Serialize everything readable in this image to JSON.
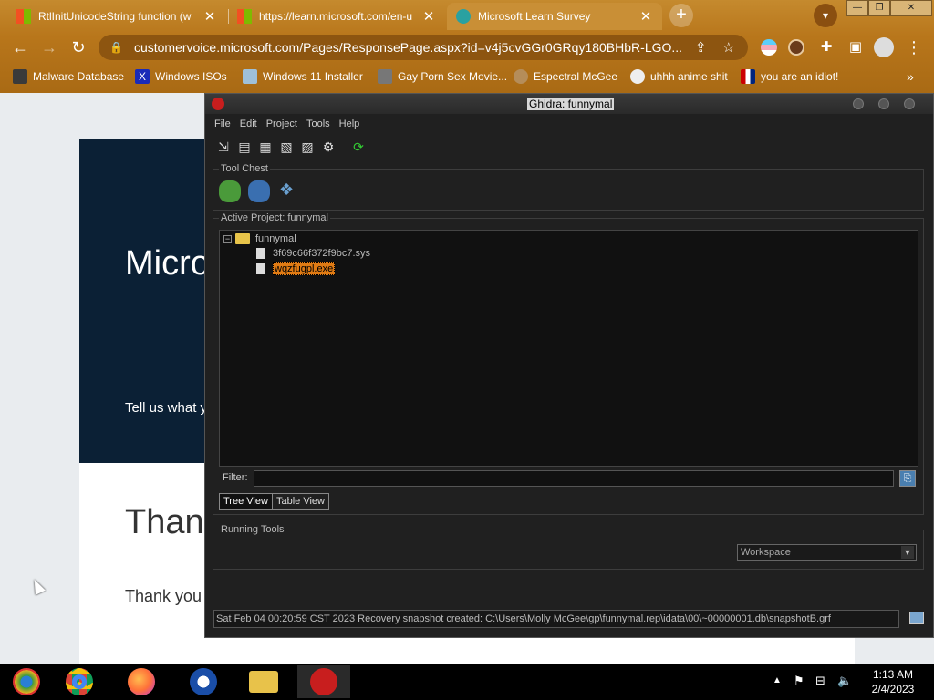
{
  "browser": {
    "tabs": [
      {
        "label": "RtlInitUnicodeString function (w",
        "close": "✕"
      },
      {
        "label": "https://learn.microsoft.com/en-u",
        "close": "✕"
      },
      {
        "label": "Microsoft Learn Survey",
        "close": "✕"
      }
    ],
    "new_tab": "+",
    "window_controls": [
      "—",
      "❐",
      "✕"
    ],
    "url": "customervoice.microsoft.com/Pages/ResponsePage.aspx?id=v4j5cvGGr0GRqy180BHbR-LGO...",
    "bookmarks": [
      {
        "label": "Malware Database"
      },
      {
        "label": "Windows ISOs"
      },
      {
        "label": "Windows 11 Installer"
      },
      {
        "label": "Gay Porn Sex Movie..."
      },
      {
        "label": "Espectral McGee"
      },
      {
        "label": "uhhh anime shit"
      },
      {
        "label": "you are an idiot!"
      }
    ],
    "bookmarks_more": "»"
  },
  "webpage": {
    "hero_title": "Microsoft Learn Survey",
    "hero_text": "Tell us what you think",
    "thanks_title": "Thank you",
    "thanks_text": "Thank you for your feedback"
  },
  "ghidra": {
    "title": "Ghidra: funnymal",
    "menu": [
      "File",
      "Edit",
      "Project",
      "Tools",
      "Help"
    ],
    "tool_chest_label": "Tool Chest",
    "active_project_label": "Active Project: funnymal",
    "tree": {
      "root": "funnymal",
      "files": [
        "3f69c66f372f9bc7.sys",
        "wqzfugpl.exe"
      ]
    },
    "filter_label": "Filter:",
    "filter_value": "",
    "tabs": [
      "Tree View",
      "Table View"
    ],
    "running_tools_label": "Running Tools",
    "workspace": "Workspace",
    "status": "Sat Feb 04 00:20:59 CST 2023 Recovery snapshot created: C:\\Users\\Molly McGee\\gp\\funnymal.rep\\idata\\00\\~00000001.db\\snapshotB.grf"
  },
  "taskbar": {
    "time": "1:13 AM",
    "date": "2/4/2023"
  },
  "colors": {
    "chrome_bg": "#b8761b",
    "ghidra_bg": "#202020",
    "selection": "#e07b14"
  }
}
